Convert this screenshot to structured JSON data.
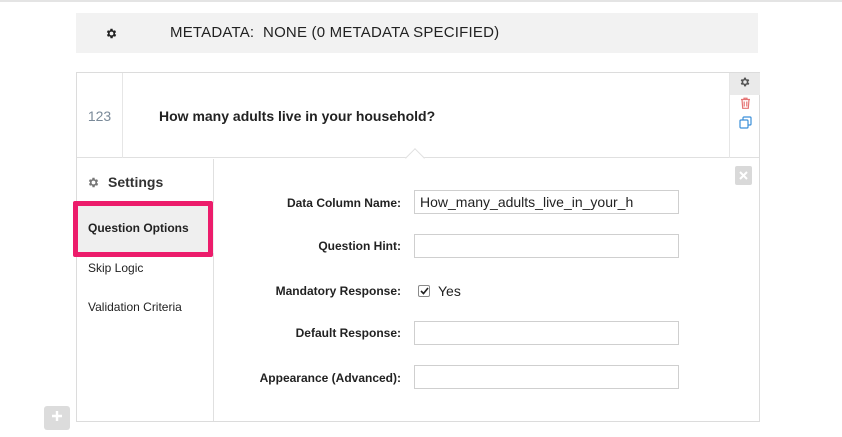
{
  "metadata_bar": {
    "text": "METADATA:  NONE (0 METADATA SPECIFIED)",
    "icon": "gear-icon"
  },
  "question": {
    "number": "123",
    "text": "How many adults live in your household?",
    "actions": [
      "gear-icon",
      "trash-icon",
      "duplicate-icon"
    ]
  },
  "settings": {
    "title": "Settings",
    "nav": [
      {
        "label": "Question Options",
        "active": true
      },
      {
        "label": "Skip Logic",
        "active": false
      },
      {
        "label": "Validation Criteria",
        "active": false
      }
    ]
  },
  "form": {
    "data_column_label": "Data Column Name:",
    "data_column_value": "How_many_adults_live_in_your_h",
    "question_hint_label": "Question Hint:",
    "question_hint_value": "",
    "mandatory_label": "Mandatory Response:",
    "mandatory_checked": true,
    "mandatory_option": "Yes",
    "default_response_label": "Default Response:",
    "default_response_value": "",
    "appearance_label": "Appearance (Advanced):",
    "appearance_value": ""
  },
  "colors": {
    "highlight": "#ec1c6b",
    "trash": "#e57373",
    "duplicate": "#3b8fd9",
    "icon_gray": "#555555"
  }
}
